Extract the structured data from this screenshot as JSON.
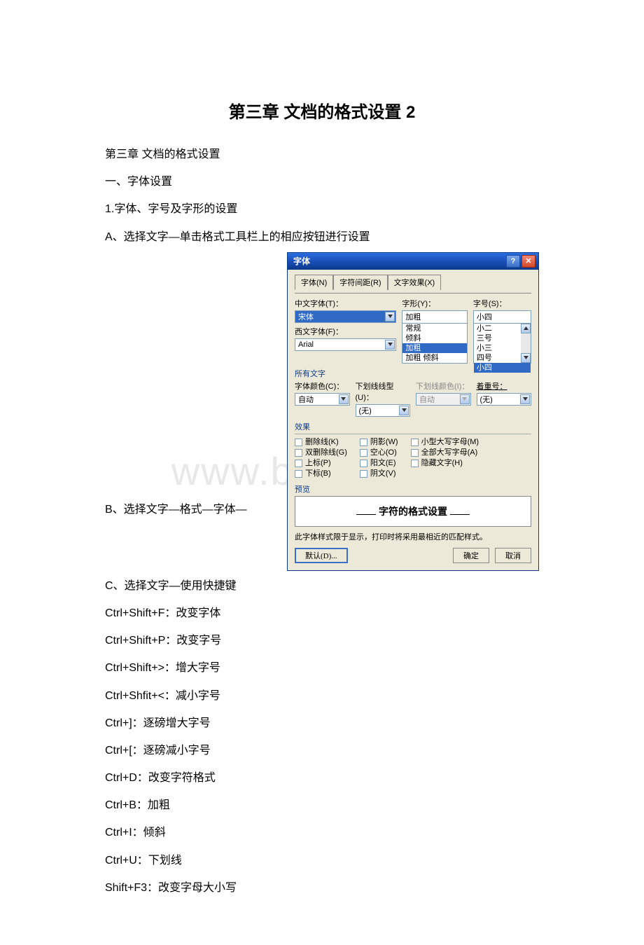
{
  "doc": {
    "title": "第三章 文档的格式设置 2",
    "lines_before": [
      "第三章 文档的格式设置",
      "一、字体设置",
      "1.字体、字号及字形的设置",
      "A、选择文字—单击格式工具栏上的相应按钮进行设置"
    ],
    "line_b": "B、选择文字—格式—字体—",
    "lines_after": [
      "C、选择文字—使用快捷键",
      "Ctrl+Shift+F：改变字体",
      "Ctrl+Shift+P：改变字号",
      "Ctrl+Shift+>：增大字号",
      "Ctrl+Shfit+<：减小字号",
      "Ctrl+]：逐磅增大字号",
      "Ctrl+[：逐磅减小字号",
      "Ctrl+D：改变字符格式",
      "Ctrl+B：加粗",
      "Ctrl+I：倾斜",
      "Ctrl+U：下划线",
      "Shift+F3：改变字母大小写"
    ]
  },
  "dialog": {
    "title": "字体",
    "tabs": {
      "t1": "字体(N)",
      "t2": "字符间距(R)",
      "t3": "文字效果(X)"
    },
    "labels": {
      "cn_font": "中文字体(T)：",
      "en_font": "西文字体(F)：",
      "style": "字形(Y)：",
      "size": "字号(S)：",
      "all_text": "所有文字",
      "font_color": "字体颜色(C)：",
      "underline_style": "下划线线型(U)：",
      "underline_color": "下划线颜色(I)：",
      "emphasis": "着重号：",
      "effects_hdr": "效果",
      "preview_hdr": "预览"
    },
    "values": {
      "cn_font": "宋体",
      "en_font": "Arial",
      "style_list": [
        "常规",
        "倾斜",
        "加粗",
        "加粗 倾斜"
      ],
      "style_selected": "加粗",
      "size_list": [
        "小二",
        "三号",
        "小三",
        "四号",
        "小四"
      ],
      "size_selected": "小四",
      "font_color": "自动",
      "underline_style": "(无)",
      "underline_color": "自动",
      "emphasis": "(无)"
    },
    "effects": {
      "c1": [
        "删除线(K)",
        "双删除线(G)",
        "上标(P)",
        "下标(B)"
      ],
      "c2": [
        "阴影(W)",
        "空心(O)",
        "阳文(E)",
        "阴文(V)"
      ],
      "c3": [
        "小型大写字母(M)",
        "全部大写字母(A)",
        "隐藏文字(H)"
      ]
    },
    "preview_text": "字符的格式设置",
    "hint": "此字体样式限于显示，打印时将采用最相近的匹配样式。",
    "buttons": {
      "default": "默认(D)...",
      "ok": "确定",
      "cancel": "取消"
    }
  },
  "watermark": "www.bdocx.com"
}
